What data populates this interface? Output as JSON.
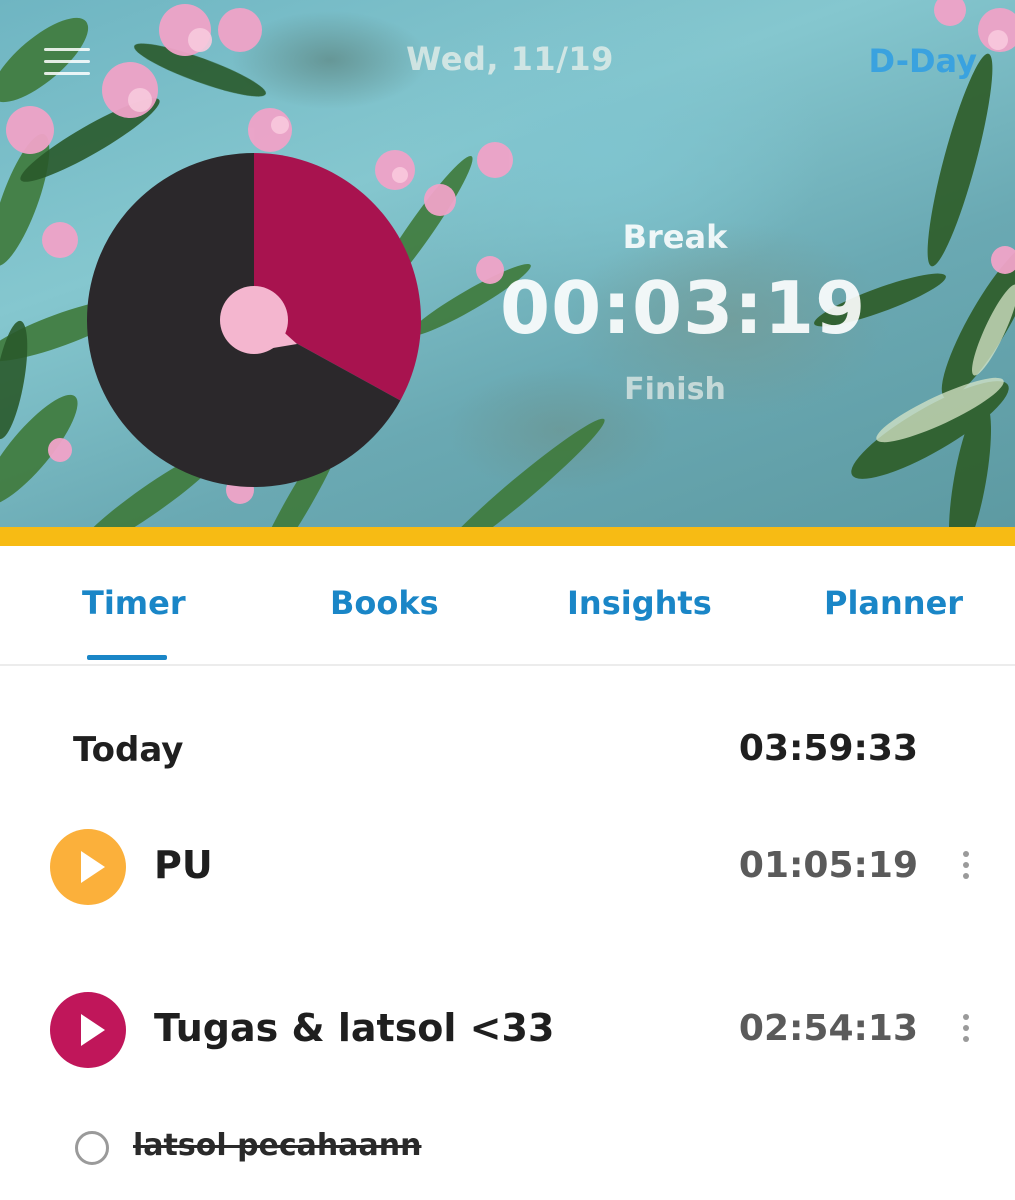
{
  "header": {
    "date": "Wed, 11/19",
    "dday_label": "D-Day",
    "status": "Break",
    "timer": "00:03:19",
    "finish_label": "Finish",
    "pie": {
      "segments": [
        {
          "fraction": 0.33,
          "color": "#a8134f"
        },
        {
          "fraction": 0.67,
          "color": "#2b282b"
        }
      ],
      "center_color": "#f4b6cf"
    }
  },
  "colors": {
    "accent_bar": "#f7bb14",
    "tab_text": "#1a86c7",
    "dday": "#3aa2df"
  },
  "tabs": [
    {
      "label": "Timer",
      "active": true
    },
    {
      "label": "Books",
      "active": false
    },
    {
      "label": "Insights",
      "active": false
    },
    {
      "label": "Planner",
      "active": false
    }
  ],
  "today": {
    "label": "Today",
    "total": "03:59:33"
  },
  "subjects": [
    {
      "name": "PU",
      "time": "01:05:19",
      "color": "#fbb03b",
      "icon": "play-icon"
    },
    {
      "name": "Tugas & latsol <33",
      "time": "02:54:13",
      "color": "#c0165a",
      "icon": "play-icon"
    }
  ],
  "tasks": [
    {
      "label": "latsol pecahaann",
      "done": true
    }
  ]
}
